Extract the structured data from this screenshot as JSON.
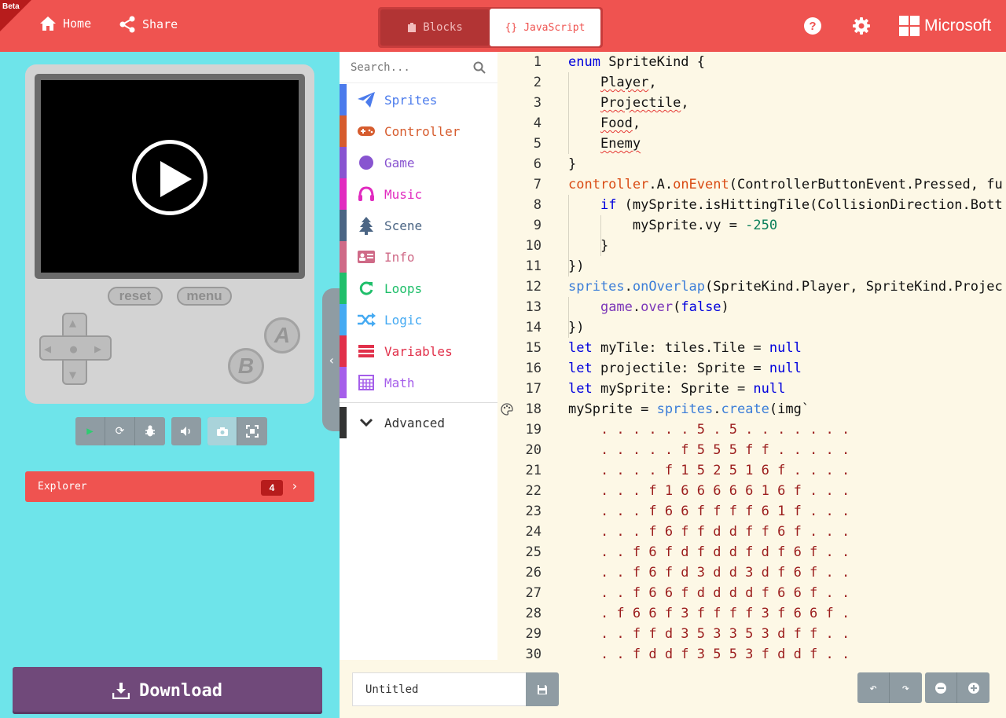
{
  "header": {
    "beta": "Beta",
    "home_label": "Home",
    "share_label": "Share",
    "blocks_label": "Blocks",
    "js_label": "JavaScript",
    "help_label": "?",
    "brand": "Microsoft"
  },
  "simulator": {
    "reset_label": "reset",
    "menu_label": "menu",
    "a_label": "A",
    "b_label": "B"
  },
  "explorer": {
    "label": "Explorer",
    "count": "4"
  },
  "download": {
    "label": "Download"
  },
  "toolbox": {
    "search_placeholder": "Search...",
    "categories": [
      {
        "label": "Sprites",
        "color": "#4b7bec",
        "icon": "paper-plane-icon"
      },
      {
        "label": "Controller",
        "color": "#d65c2e",
        "icon": "gamepad-icon"
      },
      {
        "label": "Game",
        "color": "#8854d0",
        "icon": "circle-icon"
      },
      {
        "label": "Music",
        "color": "#e12bbf",
        "icon": "headphones-icon"
      },
      {
        "label": "Scene",
        "color": "#4b6584",
        "icon": "tree-icon"
      },
      {
        "label": "Info",
        "color": "#cf6a87",
        "icon": "id-card-icon"
      },
      {
        "label": "Loops",
        "color": "#20bf6b",
        "icon": "refresh-icon"
      },
      {
        "label": "Logic",
        "color": "#45aaf2",
        "icon": "shuffle-icon"
      },
      {
        "label": "Variables",
        "color": "#e1304a",
        "icon": "list-icon"
      },
      {
        "label": "Math",
        "color": "#a55eea",
        "icon": "calculator-icon"
      }
    ],
    "advanced_label": "Advanced",
    "advanced_color": "#333333"
  },
  "editor": {
    "line_numbers": [
      "1",
      "2",
      "3",
      "4",
      "5",
      "6",
      "7",
      "8",
      "9",
      "10",
      "11",
      "12",
      "13",
      "14",
      "15",
      "16",
      "17",
      "18",
      "19",
      "20",
      "21",
      "22",
      "23",
      "24",
      "25",
      "26",
      "27",
      "28",
      "29",
      "30"
    ],
    "lines": [
      "enum SpriteKind {",
      "    Player,",
      "    Projectile,",
      "    Food,",
      "    Enemy",
      "}",
      "controller.A.onEvent(ControllerButtonEvent.Pressed, fu",
      "    if (mySprite.isHittingTile(CollisionDirection.Bott",
      "        mySprite.vy = -250",
      "    }",
      "})",
      "sprites.onOverlap(SpriteKind.Player, SpriteKind.Projec",
      "    game.over(false)",
      "})",
      "let myTile: tiles.Tile = null",
      "let projectile: Sprite = null",
      "let mySprite: Sprite = null",
      "mySprite = sprites.create(img`",
      "    . . . . . . 5 . 5 . . . . . . .",
      "    . . . . . f 5 5 5 f f . . . . .",
      "    . . . . f 1 5 2 5 1 6 f . . . .",
      "    . . . f 1 6 6 6 6 6 1 6 f . . .",
      "    . . . f 6 6 f f f f 6 1 f . . .",
      "    . . . f 6 f f d d f f 6 f . . .",
      "    . . f 6 f d f d d f d f 6 f . .",
      "    . . f 6 f d 3 d d 3 d f 6 f . .",
      "    . . f 6 6 f d d d d f 6 6 f . .",
      "    . f 6 6 f 3 f f f f 3 f 6 6 f .",
      "    . . f f d 3 5 3 3 5 3 d f f . .",
      "    . . f d d f 3 5 5 3 f d d f . ."
    ]
  },
  "bottom": {
    "project_name": "Untitled"
  }
}
